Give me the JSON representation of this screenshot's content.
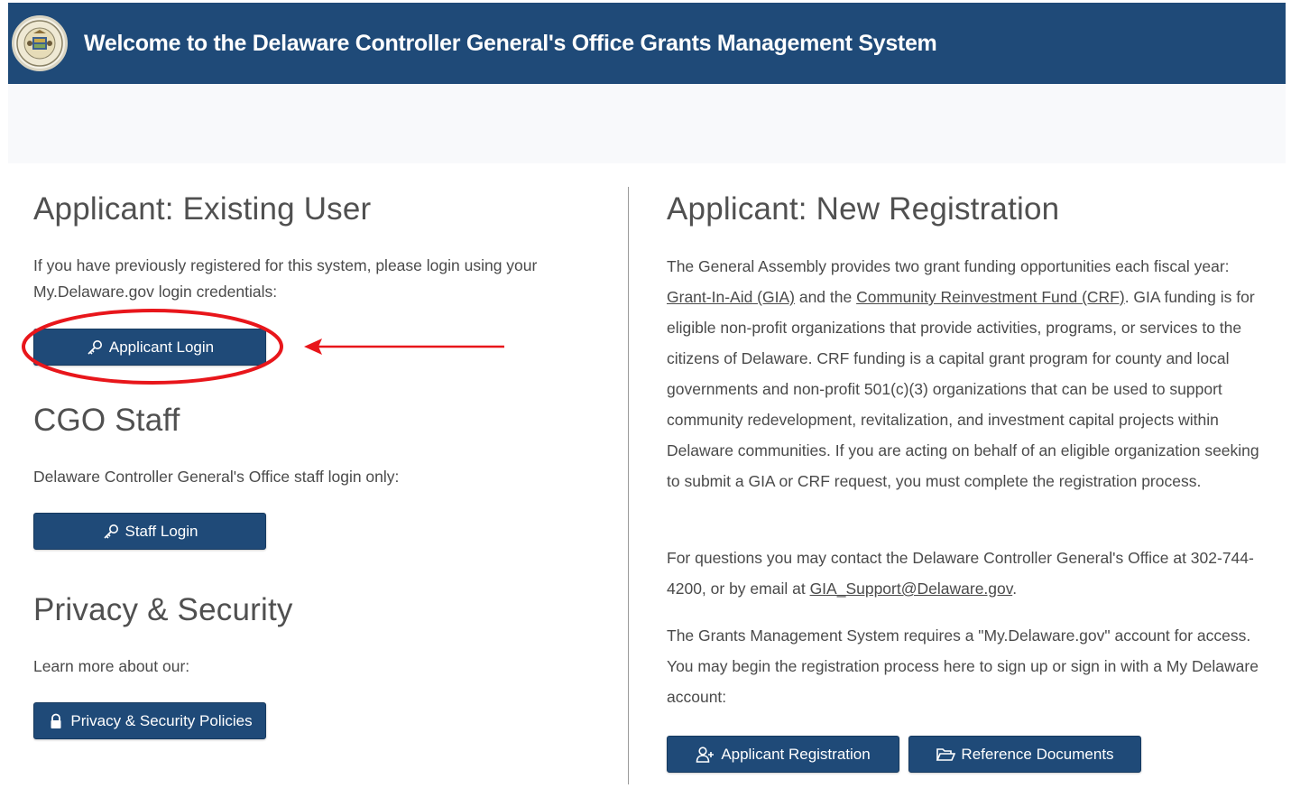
{
  "header": {
    "title": "Welcome to the Delaware Controller General's Office Grants Management System",
    "logo_icon": "state-seal-icon"
  },
  "existing_user": {
    "heading": "Applicant: Existing User",
    "text": "If you have previously registered for this system, please login using your My.Delaware.gov login credentials:",
    "login_button": "Applicant Login",
    "login_icon": "key-icon"
  },
  "staff": {
    "heading": "CGO Staff",
    "text": "Delaware Controller General's Office staff login only:",
    "login_button": "Staff Login",
    "login_icon": "key-icon"
  },
  "privacy": {
    "heading": "Privacy & Security",
    "text": "Learn more about our:",
    "button": "Privacy & Security Policies",
    "icon": "lock-icon"
  },
  "new_registration": {
    "heading": "Applicant: New Registration",
    "p1_before": "The General Assembly provides two grant funding opportunities each fiscal year: ",
    "link_gia": "Grant-In-Aid (GIA)",
    "p1_mid": " and the ",
    "link_crf": "Community Reinvestment Fund (CRF)",
    "p1_after": ". GIA funding is for eligible non-profit organizations that provide activities, programs, or services to the citizens of Delaware. CRF funding is a capital grant program for county and local governments and non-profit 501(c)(3) organizations that can be used to support community redevelopment, revitalization, and investment capital projects within Delaware communities. If you are acting on behalf of an eligible organization seeking to submit a GIA or CRF request, you must complete the registration process.",
    "p2_before": "For questions you may contact the Delaware Controller General's Office at 302-744-4200, or by email at ",
    "link_email": "GIA_Support@Delaware.gov",
    "p2_after": ".",
    "p3": "The Grants Management System requires a \"My.Delaware.gov\" account for access. You may begin the registration process here to sign up or sign in with a My Delaware account:",
    "register_button": "Applicant Registration",
    "register_icon": "user-plus-icon",
    "docs_button": "Reference Documents",
    "docs_icon": "folder-open-icon"
  },
  "annotation": {
    "color": "#e8161b"
  }
}
